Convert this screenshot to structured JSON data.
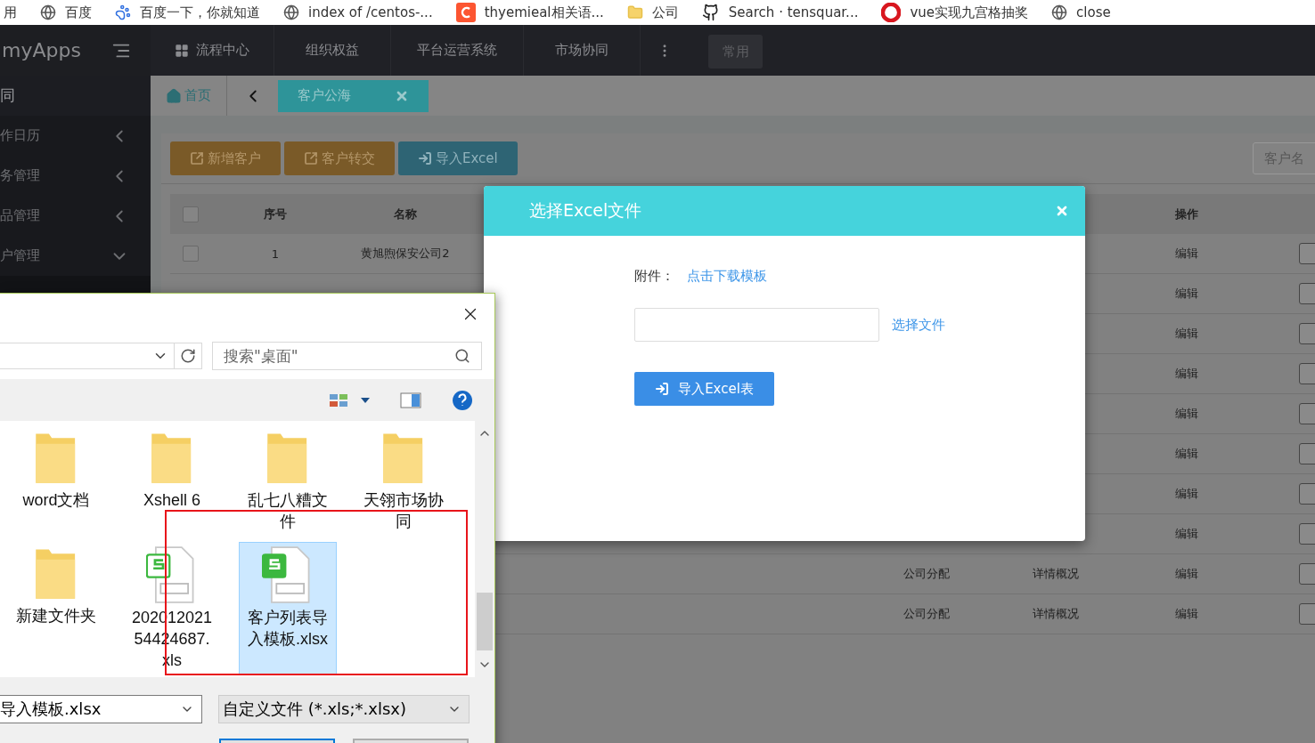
{
  "bookmarks": [
    {
      "label": "用",
      "kind": "none"
    },
    {
      "label": "百度",
      "kind": "globe"
    },
    {
      "label": "百度一下，你就知道",
      "kind": "paw"
    },
    {
      "label": "index of /centos-...",
      "kind": "globe"
    },
    {
      "label": "thyemieal相关语...",
      "kind": "letter"
    },
    {
      "label": "公司",
      "kind": "folder"
    },
    {
      "label": "Search · tensquar...",
      "kind": "github"
    },
    {
      "label": "vue实现九宫格抽奖",
      "kind": "record"
    },
    {
      "label": "close",
      "kind": "globe"
    }
  ],
  "app": {
    "logo": "myApps"
  },
  "top_nav": [
    {
      "label": "流程中心"
    },
    {
      "label": "组织权益"
    },
    {
      "label": "平台运营系统"
    },
    {
      "label": "市场协同"
    }
  ],
  "favorites_button": "常用",
  "sidebar": {
    "current_app": "同",
    "items": [
      {
        "label": "作日历",
        "expanded": false
      },
      {
        "label": "务管理",
        "expanded": false
      },
      {
        "label": "品管理",
        "expanded": false
      },
      {
        "label": "户管理",
        "expanded": true
      }
    ]
  },
  "tabs": {
    "home": "首页",
    "open": [
      {
        "label": "客户公海",
        "selected": true
      }
    ]
  },
  "toolbar": {
    "buttons": [
      {
        "label": "新增客户",
        "kind": "share"
      },
      {
        "label": "客户转交",
        "kind": "share"
      },
      {
        "label": "导入Excel",
        "kind": "import"
      }
    ],
    "search": {
      "placeholder": "客户名"
    }
  },
  "table": {
    "all_checked": false,
    "columns": [
      "序号",
      "名称",
      "操作"
    ],
    "rows": [
      {
        "checked": false,
        "index": "1",
        "name": "黄旭煦保安公司2",
        "action": "编辑"
      },
      {
        "action": "编辑"
      },
      {
        "action": "编辑"
      },
      {
        "action": "编辑"
      },
      {
        "action": "编辑"
      },
      {
        "action": "编辑"
      },
      {
        "action": "编辑"
      },
      {
        "action": "编辑"
      },
      {
        "assign": "公司分配",
        "detail": "详情概况",
        "action": "编辑"
      },
      {
        "assign": "公司分配",
        "detail": "详情概况",
        "action": "编辑"
      }
    ]
  },
  "modal": {
    "title": "选择Excel文件",
    "attachment_label": "附件：",
    "template_link": "点击下载模板",
    "choose_link": "选择文件",
    "submit": "导入Excel表"
  },
  "file_dialog": {
    "search": {
      "placeholder": "搜索\"桌面\""
    },
    "files": [
      {
        "name": "word文档",
        "kind": "folder",
        "selected": false
      },
      {
        "name": "Xshell 6",
        "kind": "folder",
        "selected": false
      },
      {
        "name": "乱七八糟文件",
        "kind": "folder",
        "selected": false
      },
      {
        "name": "天翎市场协同",
        "kind": "folder",
        "selected": false
      },
      {
        "name": "新建文件夹",
        "kind": "folder",
        "selected": false
      },
      {
        "name": "20201202154424687.xls",
        "kind": "sheet",
        "selected": false
      },
      {
        "name": "客户列表导入模板.xlsx",
        "kind": "sheet",
        "selected": true
      }
    ],
    "file_name": "导入模板.xlsx",
    "file_type": "自定义文件 (*.xls;*.xlsx)"
  }
}
